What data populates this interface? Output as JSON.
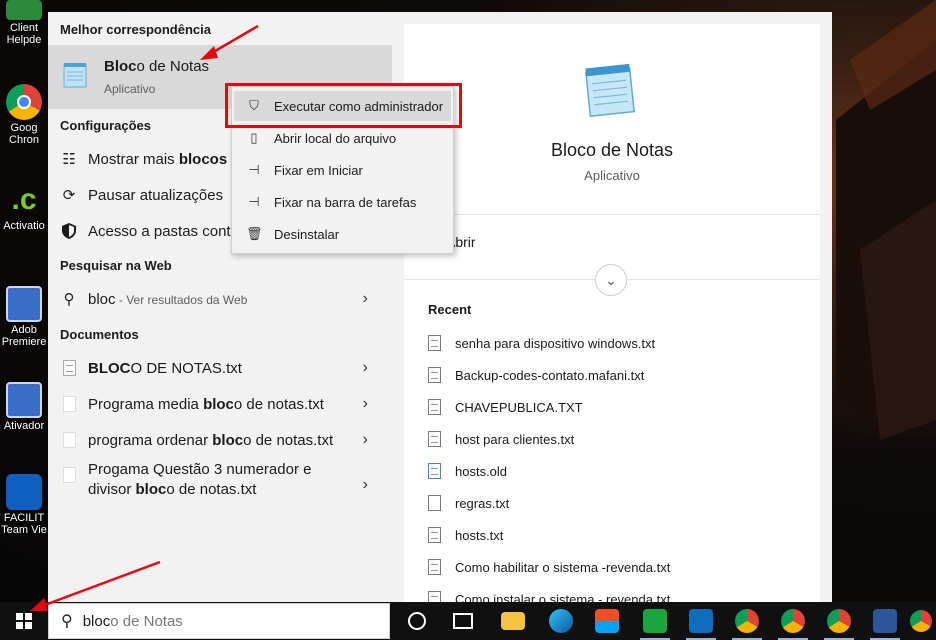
{
  "desktop": {
    "icons": [
      {
        "label": "Client\nHelpde",
        "name": "desktop-icon-client-helpdesk"
      },
      {
        "label": "Goog\nChron",
        "name": "desktop-icon-google-chrome"
      },
      {
        "label": "Activatio",
        "name": "desktop-icon-activation"
      },
      {
        "label": "Adob\nPremiere",
        "name": "desktop-icon-adobe-premiere"
      },
      {
        "label": "Ativador",
        "name": "desktop-icon-ativador"
      },
      {
        "label": "FACILIT\nTeam Vie",
        "name": "desktop-icon-teamviewer"
      }
    ]
  },
  "start_menu": {
    "best_match_header": "Melhor correspondência",
    "best_match": {
      "name_bold": "Bloc",
      "name_rest": "o de Notas",
      "type": "Aplicativo"
    },
    "settings_header": "Configurações",
    "settings": [
      {
        "pre": "Mostrar mais ",
        "bold": "blocos",
        "post": " e",
        "icon": "list-icon"
      },
      {
        "pre": "Pausar atualizações",
        "bold": "",
        "post": "",
        "icon": "refresh-icon"
      },
      {
        "pre": "Acesso a pastas contr",
        "bold": "",
        "post": "",
        "icon": "shield-icon"
      }
    ],
    "web_header": "Pesquisar na Web",
    "web_item": {
      "query": "bloc",
      "suffix": " - Ver resultados da Web"
    },
    "docs_header": "Documentos",
    "documents": [
      {
        "pre": "",
        "bold": "BLOC",
        "post": "O DE NOTAS.txt"
      },
      {
        "pre": "Programa media ",
        "bold": "bloc",
        "post": "o de notas.txt"
      },
      {
        "pre": "programa ordenar ",
        "bold": "bloc",
        "post": "o de notas.txt"
      },
      {
        "pre": "Progama Questão 3 numerador e\ndivisor ",
        "bold": "bloc",
        "post": "o de notas.txt"
      }
    ],
    "context_menu": [
      {
        "label": "Executar como administrador",
        "icon": "shield-run-icon"
      },
      {
        "label": "Abrir local do arquivo",
        "icon": "folder-open-icon"
      },
      {
        "label": "Fixar em Iniciar",
        "icon": "pin-icon"
      },
      {
        "label": "Fixar na barra de tarefas",
        "icon": "pin-taskbar-icon"
      },
      {
        "label": "Desinstalar",
        "icon": "trash-icon"
      }
    ],
    "preview": {
      "title": "Bloco de Notas",
      "subtitle": "Aplicativo",
      "open_label": "Abrir",
      "recent_header": "Recent",
      "recent": [
        "senha para dispositivo windows.txt",
        "Backup-codes-contato.mafani.txt",
        "CHAVEPUBLICA.TXT",
        "host para clientes.txt",
        "hosts.old",
        "regras.txt",
        "hosts.txt",
        "Como habilitar o sistema -revenda.txt",
        "Como instalar o sistema - revenda.txt"
      ]
    }
  },
  "taskbar": {
    "search_typed": "bloc",
    "search_completion": "o de Notas",
    "search_value": "bloco de Notas"
  },
  "colors": {
    "accent_red": "#e30613",
    "panel_bg": "#f2f2f2",
    "highlight": "#d9d9d9",
    "taskbar": "#101010"
  }
}
